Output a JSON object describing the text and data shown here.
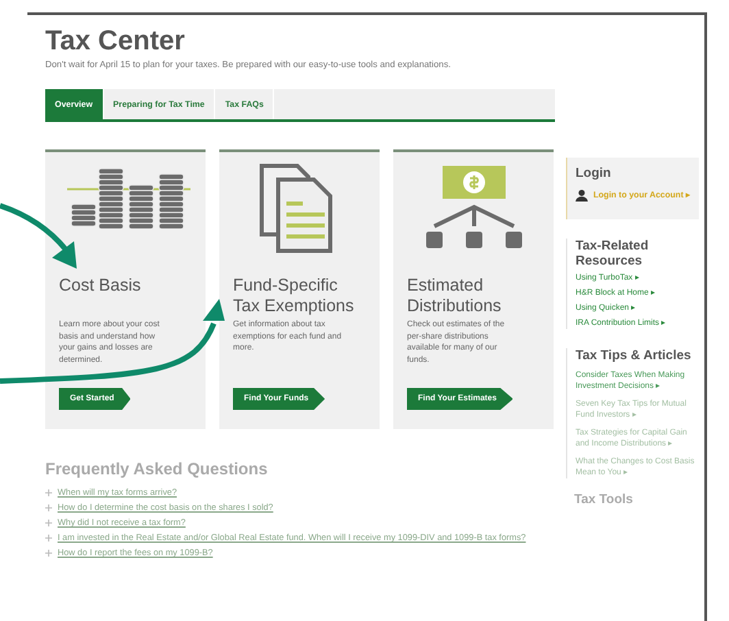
{
  "header": {
    "title": "Tax Center",
    "subtitle": "Don't wait for April 15 to plan for your taxes. Be prepared with our easy-to-use tools and explanations."
  },
  "tabs": [
    {
      "label": "Overview",
      "selected": true
    },
    {
      "label": "Preparing for Tax Time",
      "selected": false
    },
    {
      "label": "Tax FAQs",
      "selected": false
    }
  ],
  "cards": [
    {
      "kind": "coins",
      "title": "Cost Basis",
      "text": "Learn more about your cost basis and understand how your gains and losses are determined.",
      "button": "Get Started"
    },
    {
      "kind": "documents",
      "title": "Fund-Specific Tax Exemptions",
      "text": "Get information about tax exemptions for each fund and more.",
      "button": "Find Your Funds"
    },
    {
      "kind": "distribution",
      "title": "Estimated Distributions",
      "text": "Check out estimates of the per-share distributions available for many of our funds.",
      "button": "Find Your Estimates"
    }
  ],
  "faq": {
    "title": "Frequently Asked Questions",
    "items": [
      "When will my tax forms arrive?",
      "How do I determine the cost basis on the shares I sold?",
      "Why did I not receive a tax form?",
      "I am invested in the Real Estate and/or Global Real Estate fund. When will I receive my 1099-DIV and 1099-B tax forms?",
      "How do I report the fees on my 1099-B?"
    ]
  },
  "sidebar": {
    "login": {
      "title": "Login",
      "link": "Login to your Account ▸"
    },
    "resources": {
      "title": "Tax-Related Resources",
      "links": [
        "Using TurboTax ▸",
        "H&R Block at Home ▸",
        "Using Quicken ▸",
        "IRA Contribution Limits ▸"
      ]
    },
    "tips": {
      "title": "Tax Tips & Articles",
      "links": [
        "Consider Taxes When Making Investment Decisions ▸",
        "Seven Key Tax Tips for Mutual Fund Investors ▸",
        "Tax Strategies for Capital Gain and Income Distributions ▸",
        "What the Changes to Cost Basis Mean to You ▸"
      ]
    },
    "tools": {
      "title": "Tax Tools"
    }
  }
}
